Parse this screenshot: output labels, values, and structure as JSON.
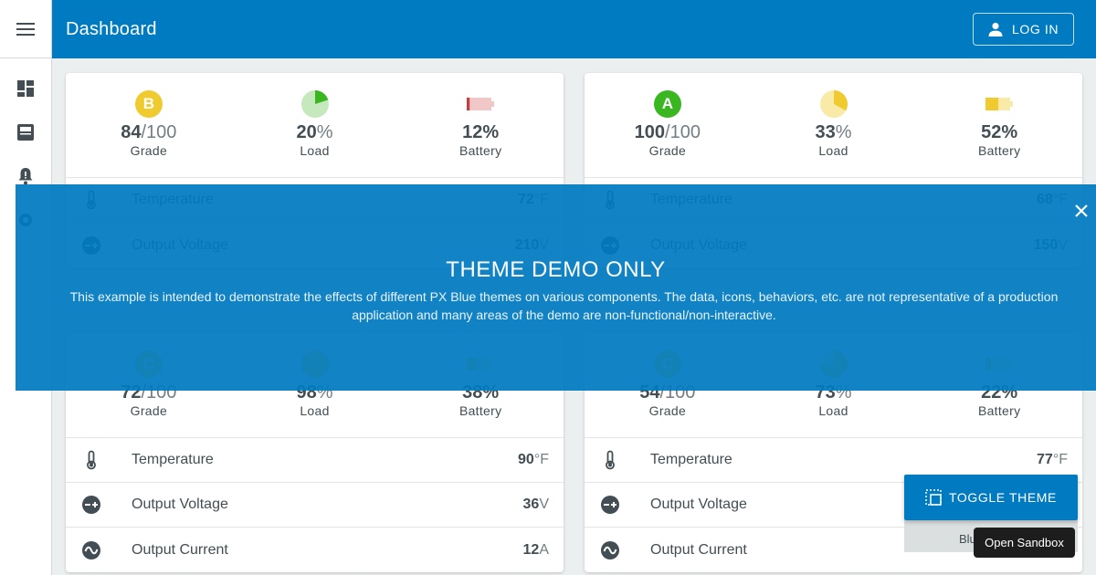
{
  "appbar": {
    "title": "Dashboard",
    "login_label": "LOG IN"
  },
  "colors": {
    "primary": "#007bc1",
    "gradeB": "#f0cb2f",
    "gradeA": "#39b620",
    "gradeC": "#f0cb2f",
    "battery_low": "#ca3c3d",
    "battery_mid": "#f0cb2f"
  },
  "labels": {
    "grade": "Grade",
    "load": "Load",
    "battery": "Battery",
    "grade_unit": "/100",
    "percent": "%"
  },
  "cards": [
    {
      "grade": {
        "letter": "B",
        "value": "84"
      },
      "load": {
        "value": "20",
        "fraction": 0.2
      },
      "battery": {
        "value": "12",
        "fraction": 0.12
      },
      "rows": [
        {
          "name": "Temperature",
          "value": "72",
          "unit": "°F",
          "icon": "thermometer-icon"
        },
        {
          "name": "Output Voltage",
          "value": "210",
          "unit": "V",
          "icon": "voltage-icon"
        }
      ]
    },
    {
      "grade": {
        "letter": "A",
        "value": "100"
      },
      "load": {
        "value": "33",
        "fraction": 0.33
      },
      "battery": {
        "value": "52",
        "fraction": 0.52
      },
      "rows": [
        {
          "name": "Temperature",
          "value": "68",
          "unit": "°F",
          "icon": "thermometer-icon"
        },
        {
          "name": "Output Voltage",
          "value": "150",
          "unit": "V",
          "icon": "voltage-icon"
        }
      ]
    },
    {
      "grade": {
        "letter": "C",
        "value": "72"
      },
      "load": {
        "value": "98",
        "fraction": 0.98
      },
      "battery": {
        "value": "38",
        "fraction": 0.38
      },
      "rows": [
        {
          "name": "Temperature",
          "value": "90",
          "unit": "°F",
          "icon": "thermometer-icon"
        },
        {
          "name": "Output Voltage",
          "value": "36",
          "unit": "V",
          "icon": "voltage-icon"
        },
        {
          "name": "Output Current",
          "value": "12",
          "unit": "A",
          "icon": "current-icon"
        }
      ]
    },
    {
      "grade": {
        "letter": "C",
        "value": "54"
      },
      "load": {
        "value": "73",
        "fraction": 0.73
      },
      "battery": {
        "value": "22",
        "fraction": 0.22
      },
      "rows": [
        {
          "name": "Temperature",
          "value": "77",
          "unit": "°F",
          "icon": "thermometer-icon"
        },
        {
          "name": "Output Voltage",
          "value": "",
          "unit": "",
          "icon": "voltage-icon"
        },
        {
          "name": "Output Current",
          "value": "",
          "unit": "",
          "icon": "current-icon"
        }
      ]
    }
  ],
  "banner": {
    "title": "THEME DEMO ONLY",
    "body": "This example is intended to demonstrate the effects of different PX Blue themes on various components. The data, icons, behaviors, etc. are not representative of a production application and many areas of the demo are non-functional/non-interactive."
  },
  "toggle": {
    "label": "TOGGLE THEME",
    "theme_name": "Blu"
  },
  "sandbox": {
    "label": "Open Sandbox"
  }
}
